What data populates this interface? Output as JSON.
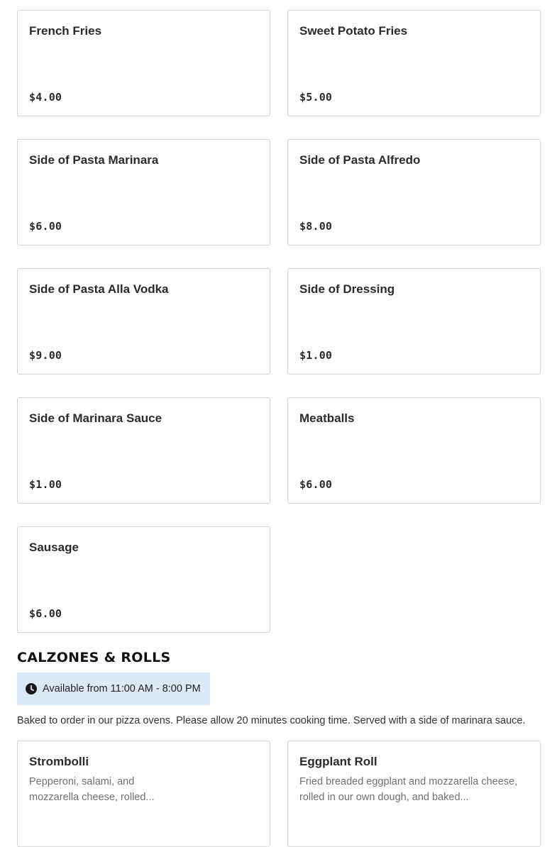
{
  "items": [
    {
      "name": "French Fries",
      "price": "$4.00"
    },
    {
      "name": "Sweet Potato Fries",
      "price": "$5.00"
    },
    {
      "name": "Side of Pasta Marinara",
      "price": "$6.00"
    },
    {
      "name": "Side of Pasta Alfredo",
      "price": "$8.00"
    },
    {
      "name": "Side of Pasta Alla Vodka",
      "price": "$9.00"
    },
    {
      "name": "Side of Dressing",
      "price": "$1.00"
    },
    {
      "name": "Side of Marinara Sauce",
      "price": "$1.00"
    },
    {
      "name": "Meatballs",
      "price": "$6.00"
    },
    {
      "name": "Sausage",
      "price": "$6.00"
    }
  ],
  "section": {
    "title": "CALZONES & ROLLS",
    "availability": "Available from 11:00 AM - 8:00 PM",
    "availability_icon": "clock-icon",
    "description": "Baked to order in our pizza ovens. Please allow 20 minutes cooking time. Served with a side of marinara sauce."
  },
  "section_items": [
    {
      "name": "Strombolli",
      "description_line1": "Pepperoni, salami, and",
      "description_line2": "mozzarella cheese, rolled..."
    },
    {
      "name": "Eggplant Roll",
      "description_line1": "Fried breaded eggplant and mozzarella cheese,",
      "description_line2": "rolled in our own dough, and baked..."
    }
  ]
}
